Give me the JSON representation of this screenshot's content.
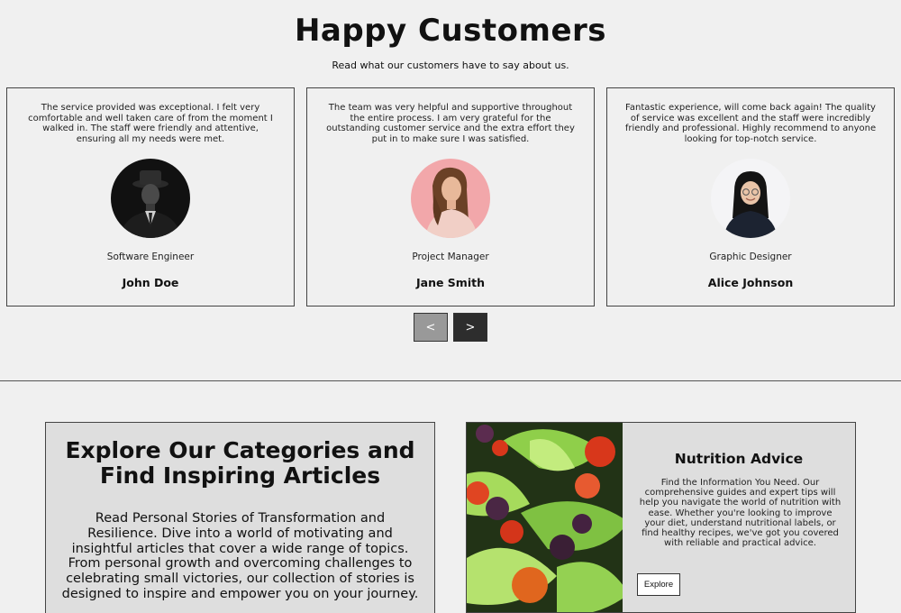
{
  "testimonials": {
    "title": "Happy Customers",
    "subtitle": "Read what our customers have to say about us.",
    "cards": [
      {
        "quote": "The service provided was exceptional. I felt very comfortable and well taken care of from the moment I walked in. The staff were friendly and attentive, ensuring all my needs were met.",
        "role": "Software Engineer",
        "name": "John Doe"
      },
      {
        "quote": "The team was very helpful and supportive throughout the entire process. I am very grateful for the outstanding customer service and the extra effort they put in to make sure I was satisfied.",
        "role": "Project Manager",
        "name": "Jane Smith"
      },
      {
        "quote": "Fantastic experience, will come back again! The quality of service was excellent and the staff were incredibly friendly and professional. Highly recommend to anyone looking for top-notch service.",
        "role": "Graphic Designer",
        "name": "Alice Johnson"
      }
    ],
    "prev_label": "<",
    "next_label": ">"
  },
  "categories": {
    "heading": "Explore Our Categories and Find Inspiring Articles",
    "body": "Read Personal Stories of Transformation and Resilience. Dive into a world of motivating and insightful articles that cover a wide range of topics. From personal growth and overcoming challenges to celebrating small victories, our collection of stories is designed to inspire and empower you on your journey."
  },
  "nutrition": {
    "title": "Nutrition Advice",
    "text": "Find the Information You Need. Our comprehensive guides and expert tips will help you navigate the world of nutrition with ease. Whether you're looking to improve your diet, understand nutritional labels, or find healthy recipes, we've got you covered with reliable and practical advice.",
    "button_label": "Explore"
  },
  "colors": {
    "background": "#f0f0f0",
    "card_border": "#444444",
    "prev_button": "#999999",
    "next_button": "#2d2d2d",
    "panel_background": "#dedede"
  }
}
